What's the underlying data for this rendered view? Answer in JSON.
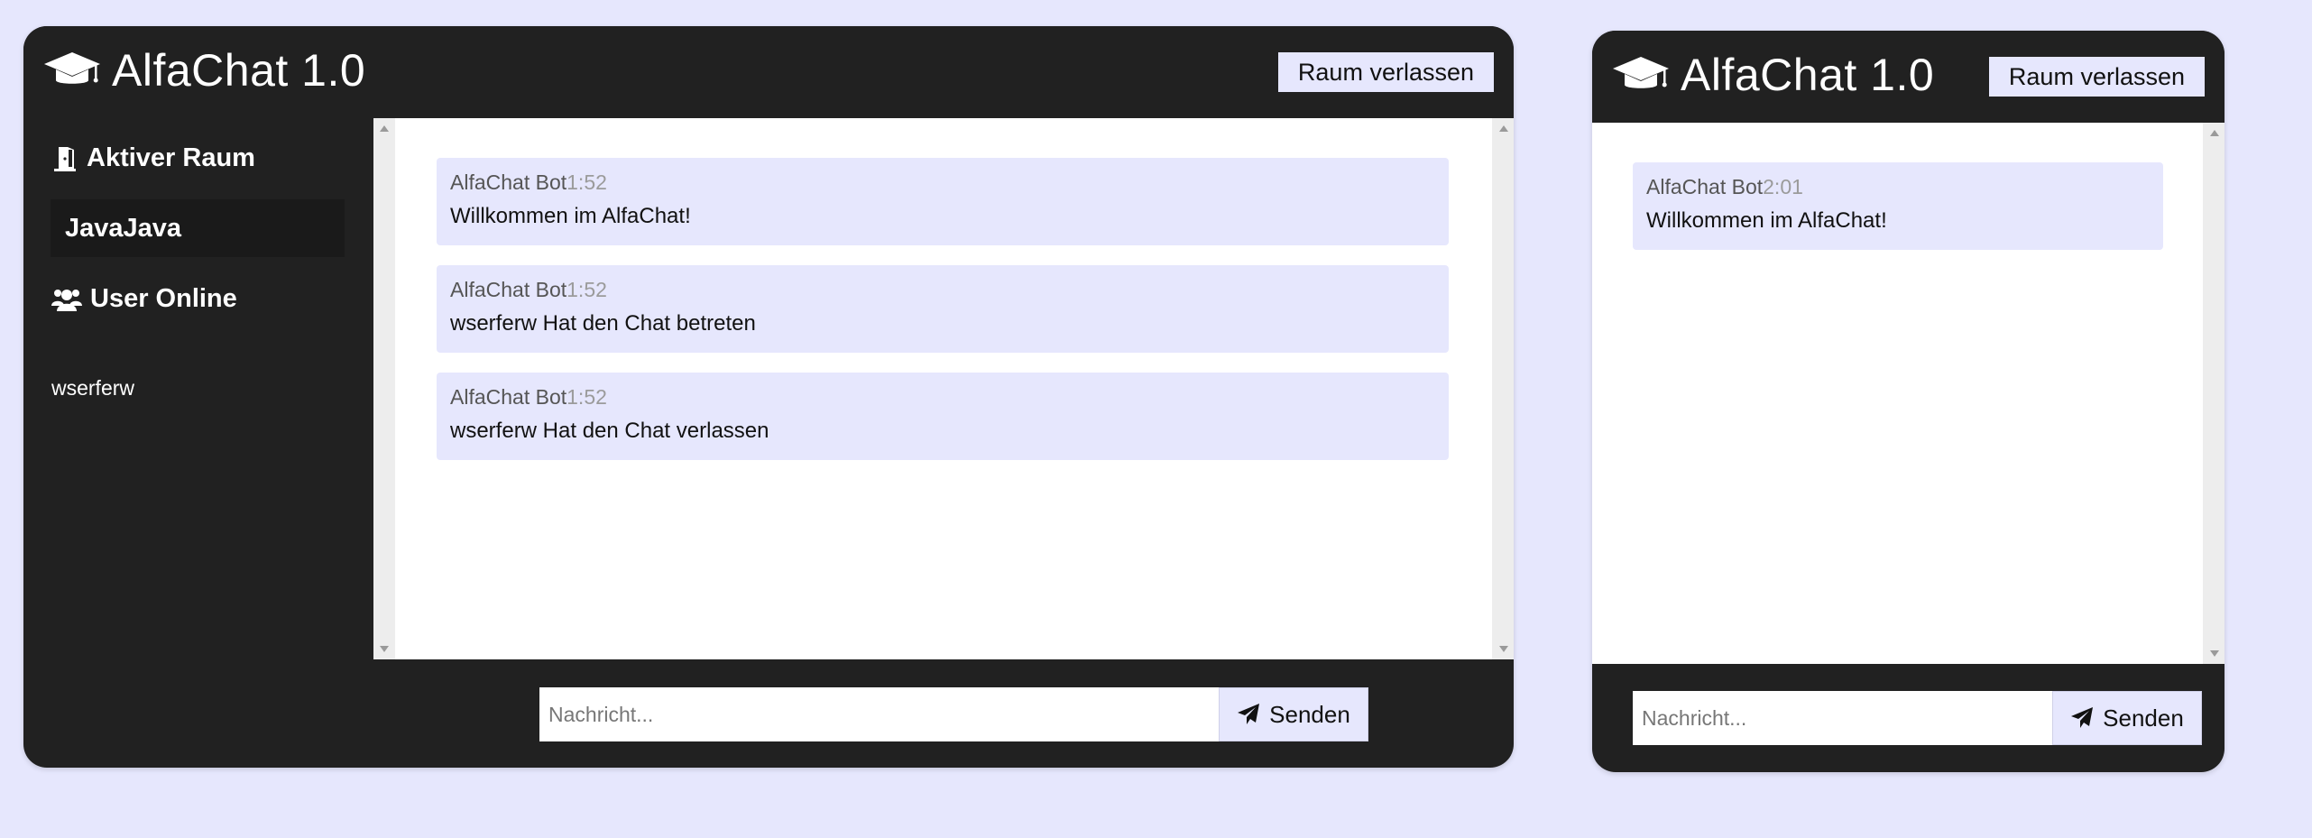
{
  "colors": {
    "background": "#e6e7fd",
    "panel": "#212121",
    "message_bg": "#e6e7fd",
    "accent_button": "#e6e7fd"
  },
  "windows": [
    {
      "title": "AlfaChat 1.0",
      "leave_label": "Raum verlassen",
      "sidebar": {
        "active_room_heading": "Aktiver Raum",
        "active_room_name": "JavaJava",
        "users_heading": "User Online",
        "users": [
          "wserferw"
        ]
      },
      "messages": [
        {
          "sender": "AlfaChat Bot",
          "time": "1:52",
          "text": "Willkommen im AlfaChat!"
        },
        {
          "sender": "AlfaChat Bot",
          "time": "1:52",
          "text": "wserferw Hat den Chat betreten"
        },
        {
          "sender": "AlfaChat Bot",
          "time": "1:52",
          "text": "wserferw Hat den Chat verlassen"
        }
      ],
      "input_placeholder": "Nachricht...",
      "send_label": "Senden"
    },
    {
      "title": "AlfaChat 1.0",
      "leave_label": "Raum verlassen",
      "messages": [
        {
          "sender": "AlfaChat Bot",
          "time": "2:01",
          "text": "Willkommen im AlfaChat!"
        }
      ],
      "input_placeholder": "Nachricht...",
      "send_label": "Senden"
    }
  ],
  "icons": {
    "brand": "graduation-cap-icon",
    "room": "door-open-icon",
    "users": "users-icon",
    "send": "paper-plane-icon"
  }
}
